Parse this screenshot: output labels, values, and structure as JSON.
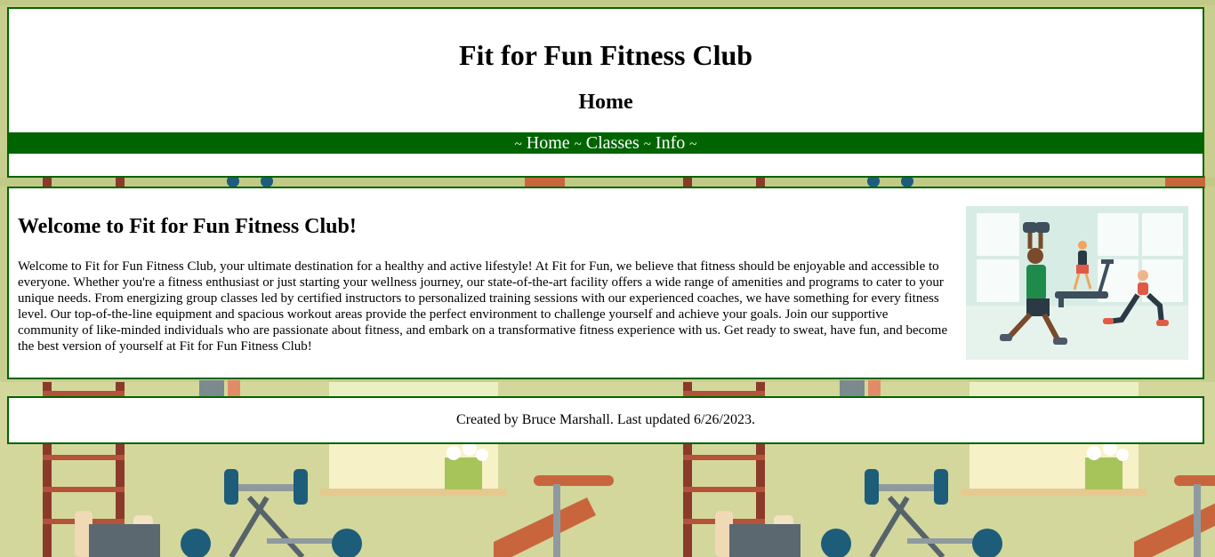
{
  "header": {
    "site_title": "Fit for Fun Fitness Club",
    "page_heading": "Home"
  },
  "nav": {
    "separator": "~",
    "items": [
      {
        "label": "Home"
      },
      {
        "label": "Classes"
      },
      {
        "label": "Info"
      }
    ]
  },
  "main": {
    "heading": "Welcome to Fit for Fun Fitness Club!",
    "paragraph": "Welcome to Fit for Fun Fitness Club, your ultimate destination for a healthy and active lifestyle! At Fit for Fun, we believe that fitness should be enjoyable and accessible to everyone. Whether you're a fitness enthusiast or just starting your wellness journey, our state-of-the-art facility offers a wide range of amenities and programs to cater to your unique needs. From energizing group classes led by certified instructors to personalized training sessions with our experienced coaches, we have something for every fitness level. Our top-of-the-line equipment and spacious workout areas provide the perfect environment to challenge yourself and achieve your goals. Join our supportive community of like-minded individuals who are passionate about fitness, and embark on a transformative fitness experience with us. Get ready to sweat, have fun, and become the best version of yourself at Fit for Fun Fitness Club!",
    "illustration_icon": "fitness-people-illustration"
  },
  "footer": {
    "credit": "Created by Bruce Marshall. Last updated 6/26/2023."
  },
  "colors": {
    "accent_green": "#006400",
    "background_wall": "#c8cf8e",
    "box_background": "#ffffff"
  }
}
